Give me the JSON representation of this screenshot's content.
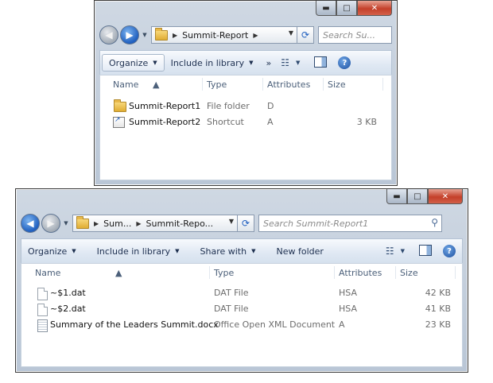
{
  "window1": {
    "caption": {
      "min": "▬",
      "max": "□",
      "close": "✕"
    },
    "address": {
      "breadcrumb": "Summit-Report",
      "separator": "▶",
      "dropdown": "▼"
    },
    "search_placeholder": "Search Su...",
    "toolbar": {
      "organize": "Organize",
      "include_in_library": "Include in library",
      "more": "»"
    },
    "columns": {
      "name": "Name",
      "type": "Type",
      "attributes": "Attributes",
      "size": "Size"
    },
    "files": [
      {
        "name": "Summit-Report1",
        "type": "File folder",
        "attributes": "D",
        "size": "",
        "icon": "folder-icon"
      },
      {
        "name": "Summit-Report2",
        "type": "Shortcut",
        "attributes": "A",
        "size": "3 KB",
        "icon": "shortcut-icon"
      }
    ]
  },
  "window2": {
    "caption": {
      "min": "▬",
      "max": "□",
      "close": "✕"
    },
    "address": {
      "crumb1": "Sum...",
      "crumb2": "Summit-Repo...",
      "separator": "▶",
      "dropdown": "▼"
    },
    "search_placeholder": "Search Summit-Report1",
    "toolbar": {
      "organize": "Organize",
      "include_in_library": "Include in library",
      "share_with": "Share with",
      "new_folder": "New folder"
    },
    "columns": {
      "name": "Name",
      "type": "Type",
      "attributes": "Attributes",
      "size": "Size"
    },
    "files": [
      {
        "name": "~$1.dat",
        "type": "DAT File",
        "attributes": "HSA",
        "size": "42 KB",
        "icon": "file-icon"
      },
      {
        "name": "~$2.dat",
        "type": "DAT File",
        "attributes": "HSA",
        "size": "41 KB",
        "icon": "file-icon"
      },
      {
        "name": "Summary of the Leaders Summit.docx",
        "type": "Office Open XML Document",
        "attributes": "A",
        "size": "23 KB",
        "icon": "doc-icon"
      }
    ]
  },
  "glyphs": {
    "back": "◀",
    "forward": "▶",
    "refresh": "⟳",
    "search": "⚲",
    "views": "☷",
    "dropdown": "▼",
    "help": "?"
  }
}
